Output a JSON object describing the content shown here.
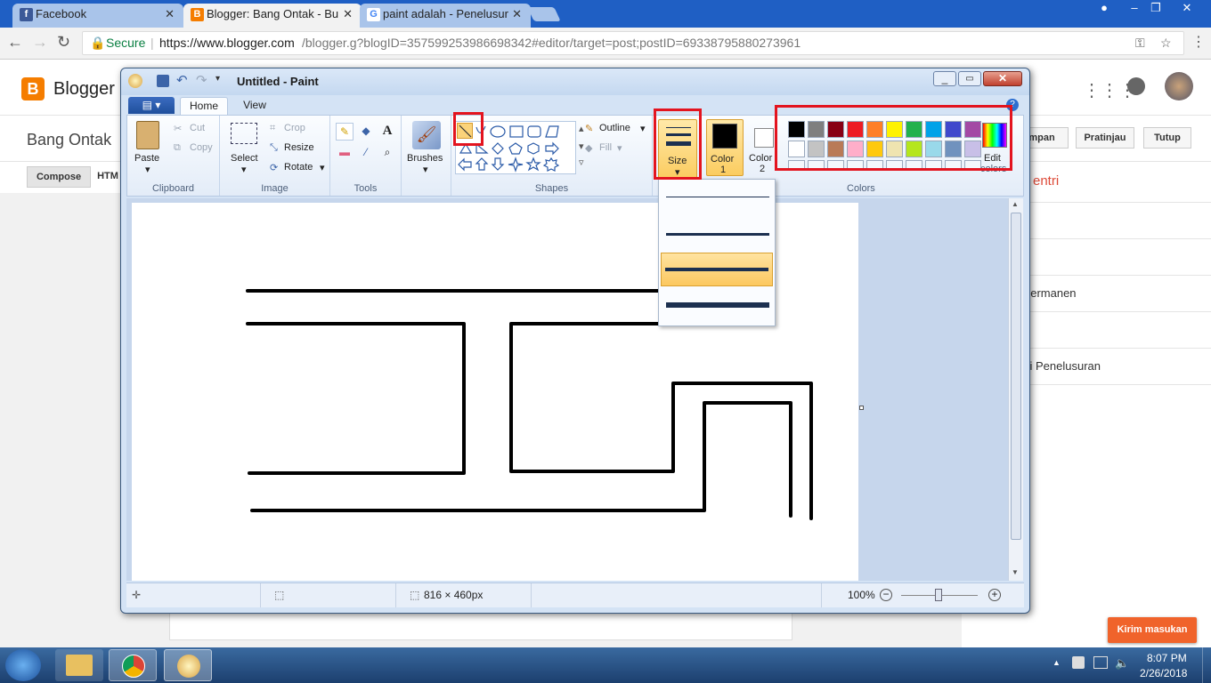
{
  "browser": {
    "tabs": [
      {
        "label": "Facebook",
        "close": "✕"
      },
      {
        "label": "Blogger: Bang Ontak - Bu",
        "close": "✕"
      },
      {
        "label": "paint adalah - Penelusur",
        "close": "✕"
      }
    ],
    "secure_label": "Secure",
    "url_host": "https://www.blogger.com",
    "url_path": "/blogger.g?blogID=357599253986698342#editor/target=post;postID=69338795880273961"
  },
  "blogger": {
    "logo_text": "Blogger",
    "blog_name": "Bang Ontak",
    "compose_label": "Compose",
    "html_label": "HTM",
    "save_label": "mpan",
    "preview_label": "Pratinjau",
    "close_label": "Tutup",
    "sidebar_items": [
      "entri",
      "",
      "",
      "permanen",
      "",
      "si Penelusuran"
    ],
    "feedback_label": "Kirim masukan"
  },
  "paint": {
    "title": "Untitled - Paint",
    "tabs": [
      "Home",
      "View"
    ],
    "clipboard": {
      "paste": "Paste",
      "cut": "Cut",
      "copy": "Copy",
      "group": "Clipboard"
    },
    "image": {
      "select": "Select",
      "crop": "Crop",
      "resize": "Resize",
      "rotate": "Rotate",
      "group": "Image"
    },
    "tools_group": "Tools",
    "brushes": "Brushes",
    "shapes": {
      "outline": "Outline",
      "fill": "Fill",
      "group": "Shapes"
    },
    "size_label": "Size",
    "color1_label": "Color",
    "color1_num": "1",
    "color2_label": "Color",
    "color2_num": "2",
    "colors_group": "Colors",
    "edit_colors": "Edit",
    "edit_colors2": "colors",
    "palette_row1": [
      "#000000",
      "#7f7f7f",
      "#880015",
      "#ed1c24",
      "#ff7f27",
      "#fff200",
      "#22b14c",
      "#00a2e8",
      "#3f48cc",
      "#a349a4"
    ],
    "palette_row2": [
      "#ffffff",
      "#c3c3c3",
      "#b97a57",
      "#ffaec9",
      "#ffc90e",
      "#efe4b0",
      "#b5e61d",
      "#99d9ea",
      "#7092be",
      "#c8bfe7"
    ],
    "status_size": "816 × 460px",
    "zoom": "100%"
  },
  "taskbar": {
    "time": "8:07 PM",
    "date": "2/26/2018"
  }
}
